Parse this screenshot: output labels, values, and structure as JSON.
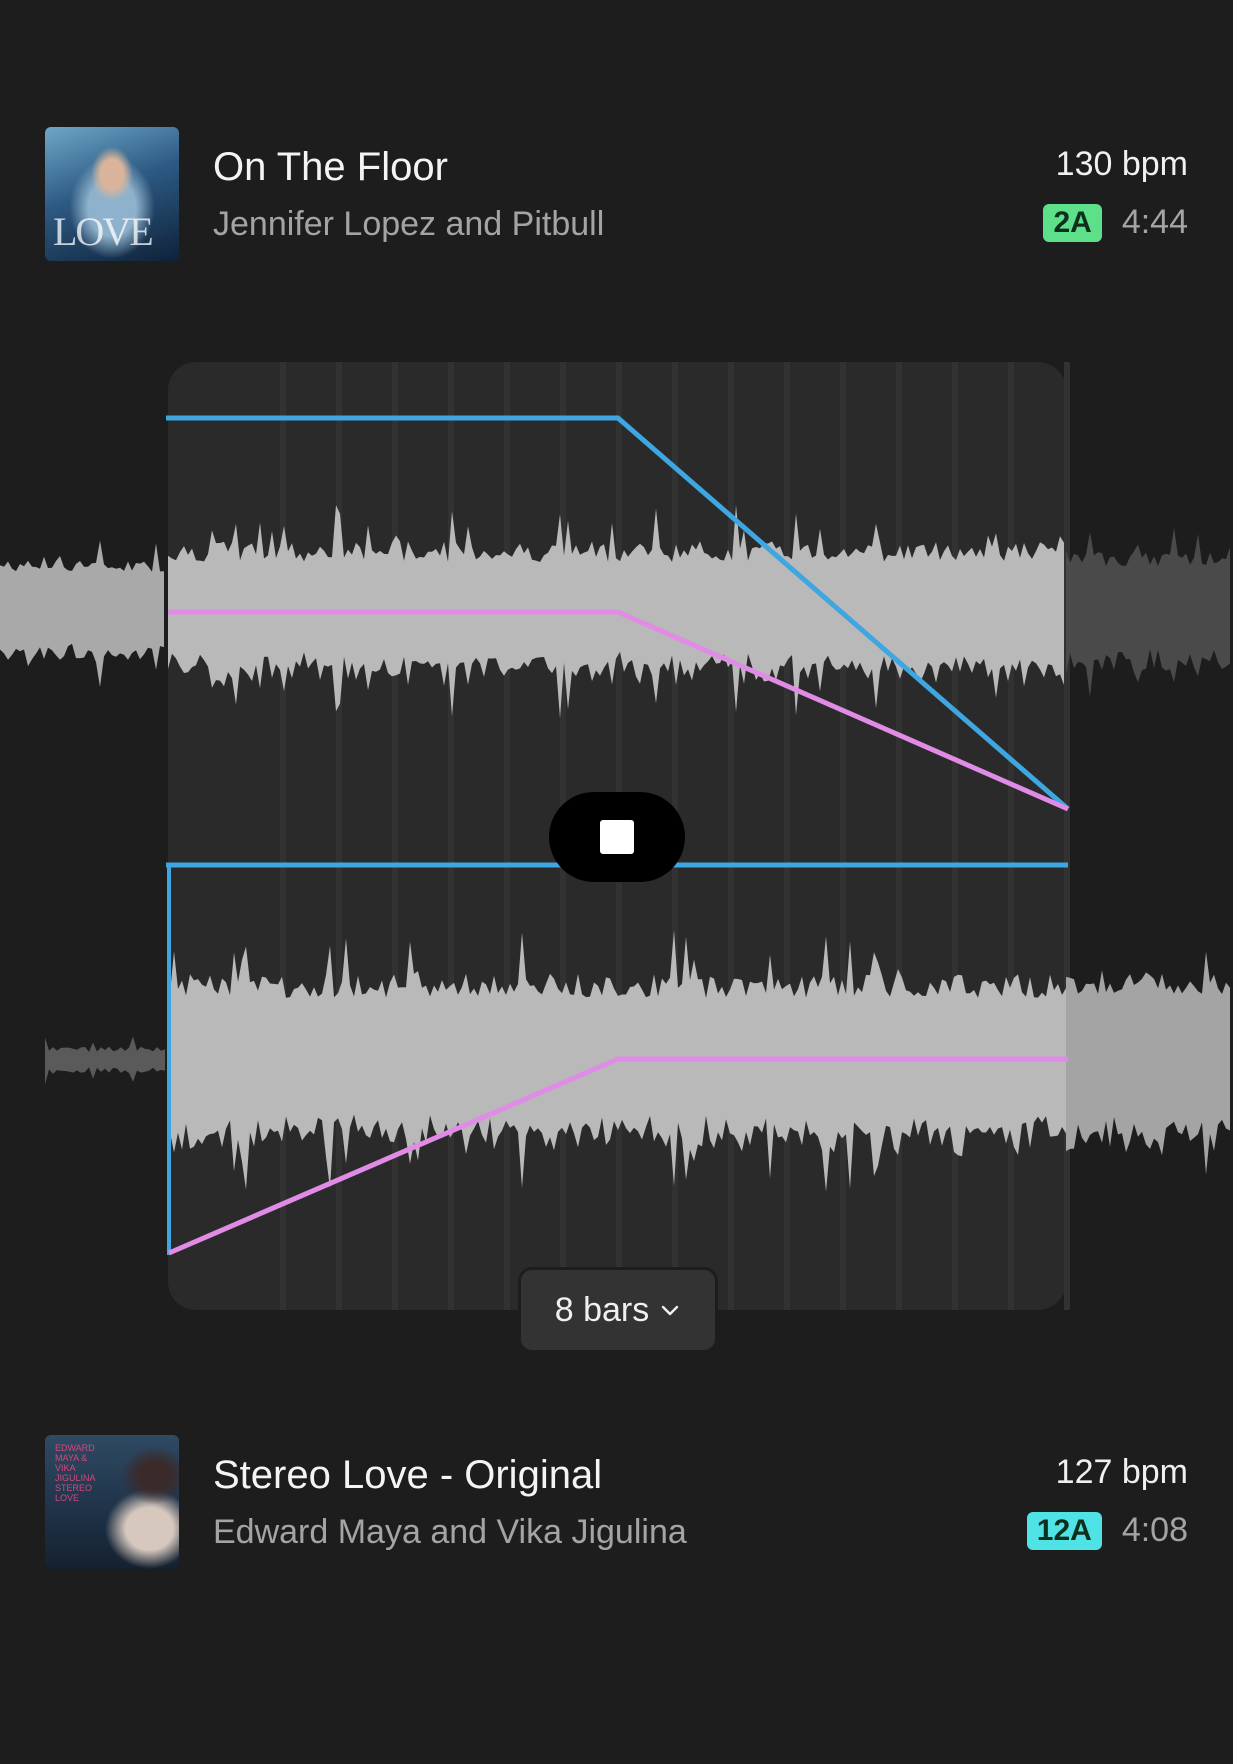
{
  "track_a": {
    "title": "On The Floor",
    "artist": "Jennifer Lopez and Pitbull",
    "bpm": "130 bpm",
    "key": "2A",
    "key_color": "#5ee08a",
    "duration": "4:44",
    "art_text": "LOVE"
  },
  "track_b": {
    "title": "Stereo Love - Original",
    "artist": "Edward Maya and Vika Jigulina",
    "bpm": "127 bpm",
    "key": "12A",
    "key_color": "#4fe3e6",
    "duration": "4:08",
    "art_text": "EDWARD MAYA & VIKA JIGULINA STEREO LOVE"
  },
  "transition": {
    "bars_label": "8 bars",
    "volume_curve_color": "#3ea6e0",
    "eq_curve_color": "#e08be6",
    "stop_icon": "stop-icon",
    "chevron_icon": "chevron-down-icon"
  }
}
